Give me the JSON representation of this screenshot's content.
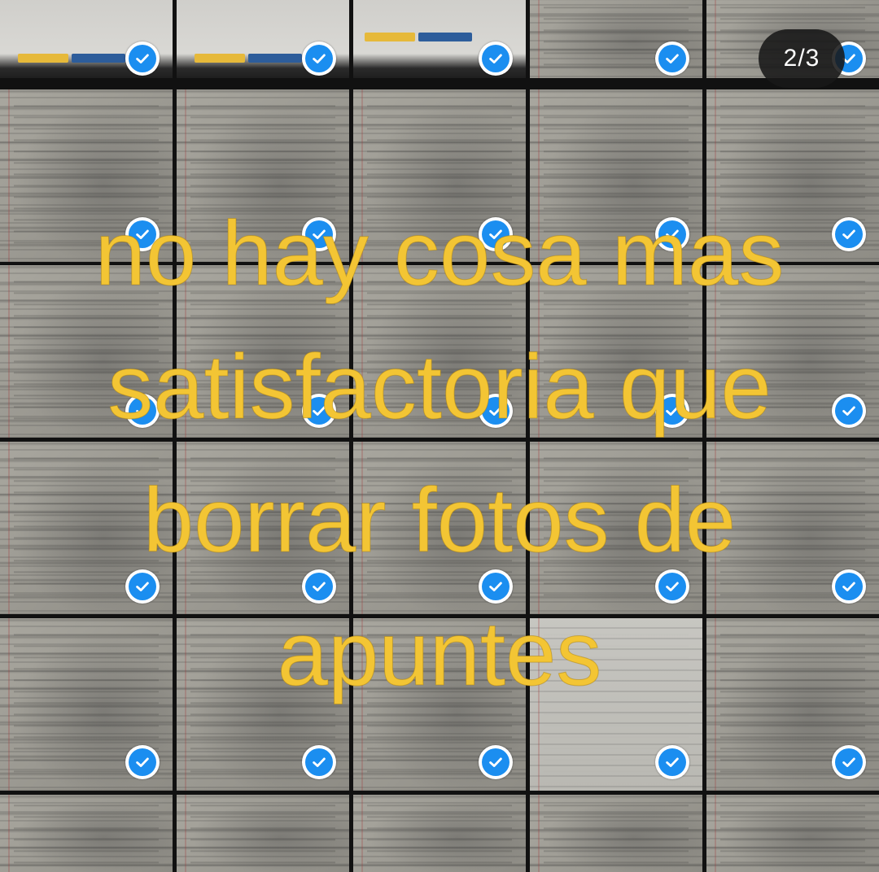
{
  "viewer": {
    "page_counter": "2/3"
  },
  "caption": {
    "lines": [
      "no hay cosa mas",
      "satisfactoria que",
      "borrar fotos de",
      "apuntes"
    ]
  },
  "selection": {
    "check_color": "#1b8ef0",
    "caption_color": "#f3c534",
    "icon": "check-circle-icon"
  },
  "photos": {
    "columns": 5,
    "rows": 5,
    "all_selected": true
  }
}
